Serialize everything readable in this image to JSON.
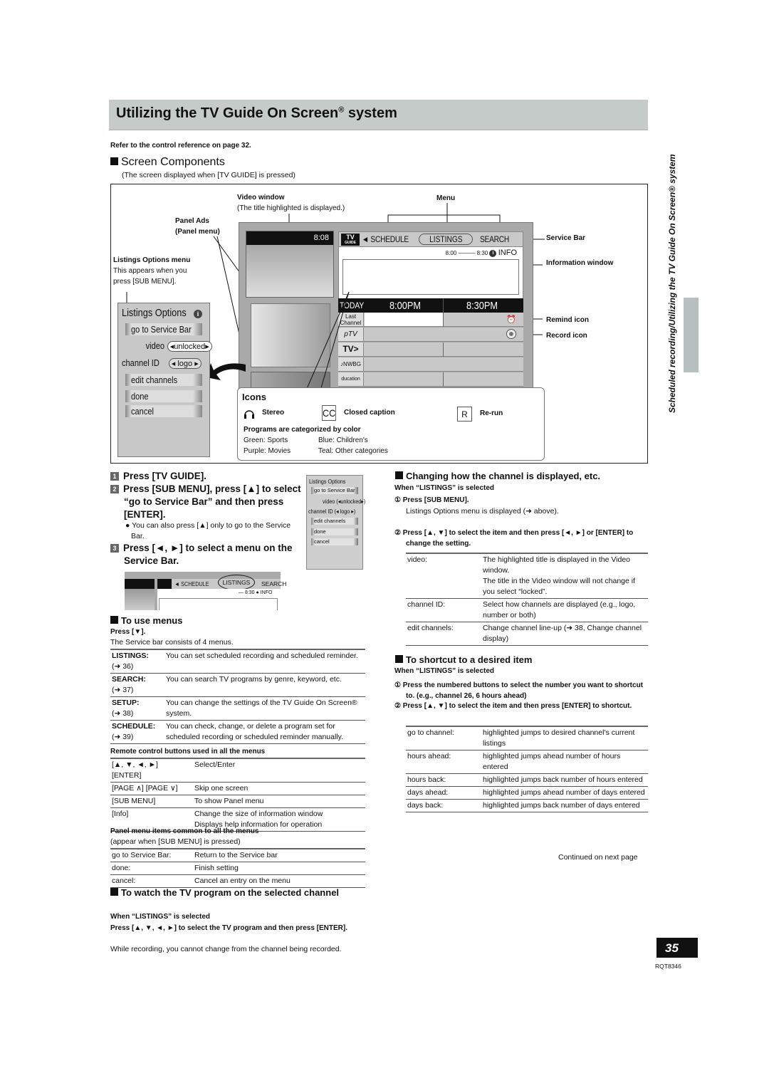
{
  "header": {
    "title": "Utilizing the TV Guide On Screen",
    "title_reg": "®",
    "title_suffix": " system",
    "refer": "Refer to the control reference on page 32."
  },
  "screen_components": {
    "heading": "Screen Components",
    "subtitle": "(The screen displayed when [TV GUIDE] is pressed)",
    "labels": {
      "video_window": "Video window",
      "video_window_note": "(The title highlighted is displayed.)",
      "menu": "Menu",
      "panel_ads": "Panel Ads",
      "panel_menu": "(Panel menu)",
      "listings_options_menu": "Listings Options menu",
      "listings_options_note1": "This appears when you",
      "listings_options_note2": "press [SUB MENU].",
      "service_bar": "Service Bar",
      "information_window": "Information window",
      "remind_icon": "Remind icon",
      "record_icon": "Record icon"
    },
    "tv_screen": {
      "clock": "8:08",
      "logo_top": "TV",
      "logo_bottom": "GUIDE",
      "menus": [
        "SCHEDULE",
        "LISTINGS",
        "SEARCH"
      ],
      "selected_menu": "LISTINGS",
      "time_start": "8:00",
      "time_end": "8:30",
      "info_label": "INFO",
      "day": "TODAY",
      "slots": [
        "8:00PM",
        "8:30PM"
      ],
      "channels": [
        "Last Channel",
        "pTV",
        "TV>",
        "NWBG",
        "ducation"
      ]
    },
    "listings_options": {
      "title": "Listings Options",
      "items": [
        "go to Service Bar",
        "edit channels",
        "done",
        "cancel"
      ],
      "video_label": "video",
      "video_value": "unlocked",
      "channel_id_label": "channel ID",
      "channel_id_value": "logo"
    },
    "icons_legend": {
      "heading": "Icons",
      "stereo": "Stereo",
      "cc_glyph": "CC",
      "closed_caption": "Closed caption",
      "rerun_glyph": "R",
      "rerun": "Re-run",
      "categories_heading": "Programs are categorized by color",
      "categories": [
        [
          "Green: Sports",
          "Blue: Children's"
        ],
        [
          "Purple: Movies",
          "Teal: Other categories"
        ]
      ]
    }
  },
  "steps": {
    "step1": "Press [TV GUIDE].",
    "step2": "Press [SUB MENU], press [▲] to select “go to Service Bar” and then press [ENTER].",
    "step2_note": "You can also press [▲] only to go to the Service Bar.",
    "step3": "Press [◄, ►] to select a menu on the Service Bar.",
    "mini_menus": [
      "SCHEDULE",
      "LISTINGS",
      "SEARCH"
    ],
    "mini_time": "8:30",
    "mini_info": "INFO"
  },
  "use_menus": {
    "heading": "To use menus",
    "press": "Press [▼].",
    "desc": "The Service bar consists of 4 menus.",
    "rows": [
      {
        "name": "LISTINGS:",
        "ref": "(➜ 36)",
        "desc": "You can set scheduled recording and scheduled reminder."
      },
      {
        "name": "SEARCH:",
        "ref": "(➜ 37)",
        "desc": "You can search TV programs by genre, keyword, etc."
      },
      {
        "name": "SETUP:",
        "ref": "(➜ 38)",
        "desc": "You can change the settings of the TV Guide On Screen® system."
      },
      {
        "name": "SCHEDULE:",
        "ref": "(➜ 39)",
        "desc": "You can check, change, or delete a program set for scheduled recording or scheduled reminder manually."
      }
    ]
  },
  "remote_buttons": {
    "heading": "Remote control buttons used in all the menus",
    "rows": [
      {
        "key": "[▲, ▼, ◄, ►]\n[ENTER]",
        "desc": "Select/Enter"
      },
      {
        "key": "[PAGE ∧] [PAGE ∨]",
        "desc": "Skip one screen"
      },
      {
        "key": "[SUB MENU]",
        "desc": "To show Panel menu"
      },
      {
        "key": "[Info]",
        "desc": "Change the size of information window\nDisplays help information for operation"
      }
    ]
  },
  "panel_menu_items": {
    "heading": "Panel menu items common to all the menus",
    "sub": "(appear when [SUB MENU] is pressed)",
    "rows": [
      {
        "key": "go to Service Bar:",
        "desc": "Return to the Service bar"
      },
      {
        "key": "done:",
        "desc": "Finish setting"
      },
      {
        "key": "cancel:",
        "desc": "Cancel an entry on the menu"
      }
    ]
  },
  "watch_program": {
    "heading": "To watch the TV program on the selected channel",
    "when": "When “LISTINGS” is selected",
    "instruction": "Press [▲, ▼, ◄, ►] to select the TV program and then press [ENTER].",
    "note": "While recording, you cannot change from the channel being recorded."
  },
  "changing_channel": {
    "heading": "Changing how the channel is displayed, etc.",
    "when": "When “LISTINGS” is selected",
    "step1": "Press [SUB MENU].",
    "step1_note": "Listings Options menu is displayed (➜ above).",
    "step2": "Press [▲, ▼] to select the item and then press [◄, ►] or [ENTER] to change the setting.",
    "rows": [
      {
        "key": "video:",
        "desc": "The highlighted title is displayed in the Video window.\nThe title in the Video window will not change if you select “locked”."
      },
      {
        "key": "channel ID:",
        "desc": "Select how channels are displayed (e.g., logo, number or both)"
      },
      {
        "key": "edit channels:",
        "desc": "Change channel line-up (➜ 38, Change channel display)"
      }
    ]
  },
  "shortcut": {
    "heading": "To shortcut to a desired item",
    "when": "When “LISTINGS” is selected",
    "step1": "Press the numbered buttons to select the number you want to shortcut to. (e.g., channel 26, 6 hours ahead)",
    "step2": "Press [▲, ▼] to select the item and then press [ENTER] to shortcut.",
    "rows": [
      {
        "key": "go to channel:",
        "desc": "highlighted jumps to desired channel’s current listings"
      },
      {
        "key": "hours ahead:",
        "desc": "highlighted jumps ahead number of hours entered"
      },
      {
        "key": "hours back:",
        "desc": "highlighted jumps back number of hours entered"
      },
      {
        "key": "days ahead:",
        "desc": "highlighted jumps ahead number of days entered"
      },
      {
        "key": "days back:",
        "desc": "highlighted jumps back number of days entered"
      }
    ]
  },
  "footer": {
    "continued": "Continued on next page",
    "page_number": "35",
    "doc_code": "RQT8346",
    "side_text": "Scheduled recording/Utilizing the TV Guide On Screen® system"
  },
  "colors": {
    "title_bar": "#c5cbc9",
    "side_tab": "#b8c0bf",
    "page_badge": "#111111"
  }
}
